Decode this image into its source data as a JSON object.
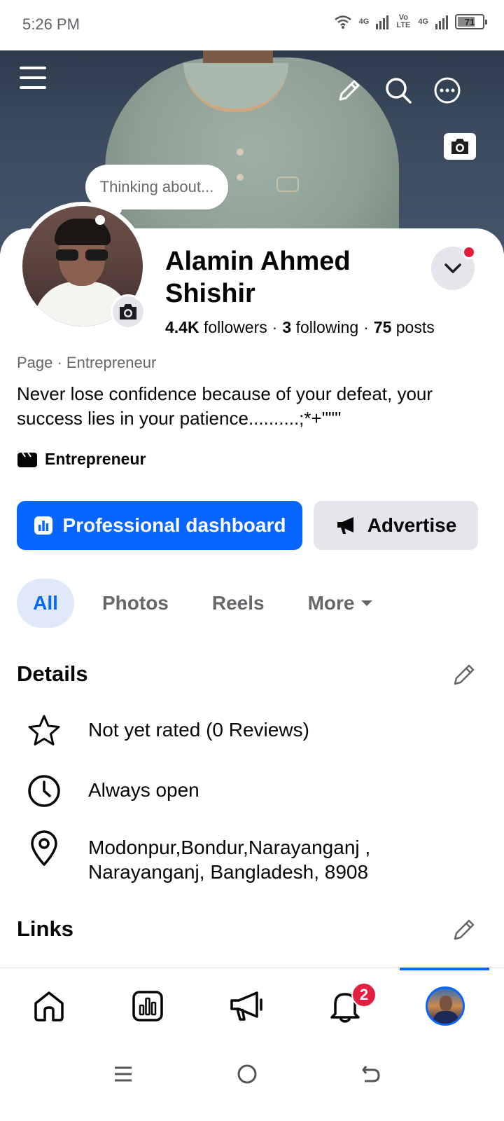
{
  "status_bar": {
    "time": "5:26 PM",
    "network1": "4G",
    "network2": "Vo LTE",
    "network3": "4G",
    "battery": "71",
    "battery_level": 0.71,
    "icons": [
      "wifi-icon",
      "signal-icon",
      "signal-icon",
      "battery-icon"
    ]
  },
  "cover": {
    "icons": [
      "menu-icon",
      "pencil-icon",
      "search-icon",
      "more-icon",
      "camera-icon"
    ],
    "thinking_prompt": "Thinking about..."
  },
  "profile": {
    "name": "Alamin Ahmed Shishir",
    "followers_count": "4.4K",
    "followers_label": "followers",
    "following_count": "3",
    "following_label": "following",
    "posts_count": "75",
    "posts_label": "posts",
    "separator": "·",
    "category": "Page · Entrepreneur",
    "bio": "Never lose confidence because of your defeat, your success lies in your patience..........;*+\"\"\"",
    "tag": "Entrepreneur"
  },
  "actions": {
    "dashboard_label": "Professional dashboard",
    "advertise_label": "Advertise"
  },
  "tabs": [
    {
      "label": "All",
      "active": true
    },
    {
      "label": "Photos",
      "active": false
    },
    {
      "label": "Reels",
      "active": false
    },
    {
      "label": "More",
      "active": false
    }
  ],
  "details": {
    "title": "Details",
    "items": [
      {
        "icon": "star-icon",
        "text": "Not yet rated (0 Reviews)"
      },
      {
        "icon": "clock-icon",
        "text": "Always open"
      },
      {
        "icon": "location-pin-icon",
        "text": "Modonpur,Bondur,Narayanganj , Narayanganj, Bangladesh, 8908"
      }
    ]
  },
  "links": {
    "title": "Links"
  },
  "bottom_nav": {
    "items": [
      "home-icon",
      "dashboard-icon",
      "megaphone-icon",
      "bell-icon",
      "profile-avatar"
    ],
    "notification_badge": "2"
  },
  "colors": {
    "accent": "#0866ff",
    "badge": "#e41e3f",
    "secondary_text": "#65676b",
    "button_gray": "#e4e6eb"
  }
}
